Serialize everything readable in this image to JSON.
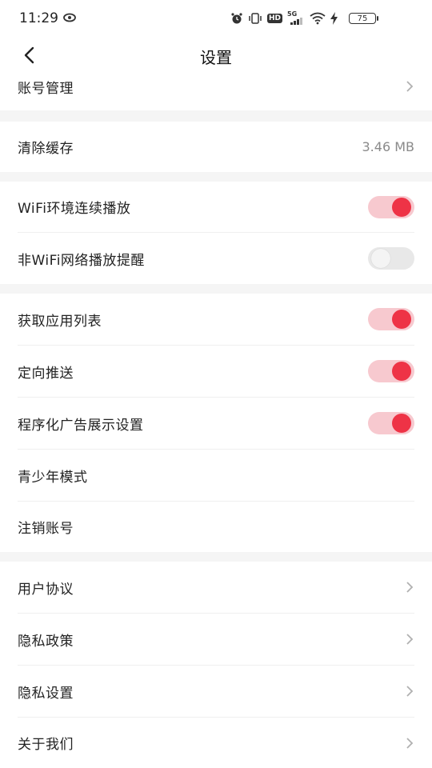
{
  "status_bar": {
    "time": "11:29",
    "network": "5G",
    "hd_badge": "HD",
    "battery": "75"
  },
  "nav": {
    "title": "设置"
  },
  "sections": {
    "account": {
      "label": "账号管理"
    },
    "cache": {
      "label": "清除缓存",
      "value": "3.46 MB"
    },
    "wifi_autoplay": {
      "label": "WiFi环境连续播放",
      "enabled": true
    },
    "non_wifi_reminder": {
      "label": "非WiFi网络播放提醒",
      "enabled": false
    },
    "app_list": {
      "label": "获取应用列表",
      "enabled": true
    },
    "targeted_push": {
      "label": "定向推送",
      "enabled": true
    },
    "programmatic_ads": {
      "label": "程序化广告展示设置",
      "enabled": true
    },
    "teen_mode": {
      "label": "青少年模式"
    },
    "delete_account": {
      "label": "注销账号"
    },
    "user_agreement": {
      "label": "用户协议"
    },
    "privacy_policy": {
      "label": "隐私政策"
    },
    "privacy_settings": {
      "label": "隐私设置"
    },
    "about_us": {
      "label": "关于我们"
    }
  },
  "colors": {
    "accent": "#ee3346",
    "toggle_on_track": "#f7c9cf",
    "section_gap": "#f5f5f5"
  }
}
